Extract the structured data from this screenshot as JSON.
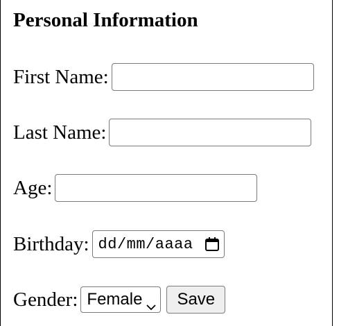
{
  "form": {
    "title": "Personal Information",
    "first_name": {
      "label": "First Name:",
      "value": ""
    },
    "last_name": {
      "label": "Last Name:",
      "value": ""
    },
    "age": {
      "label": "Age:",
      "value": ""
    },
    "birthday": {
      "label": "Birthday:",
      "placeholder": "dd/mm/aaaa",
      "icon": "calendar-icon"
    },
    "gender": {
      "label": "Gender:",
      "selected": "Female",
      "icon": "chevron-down-icon"
    },
    "save_label": "Save"
  }
}
